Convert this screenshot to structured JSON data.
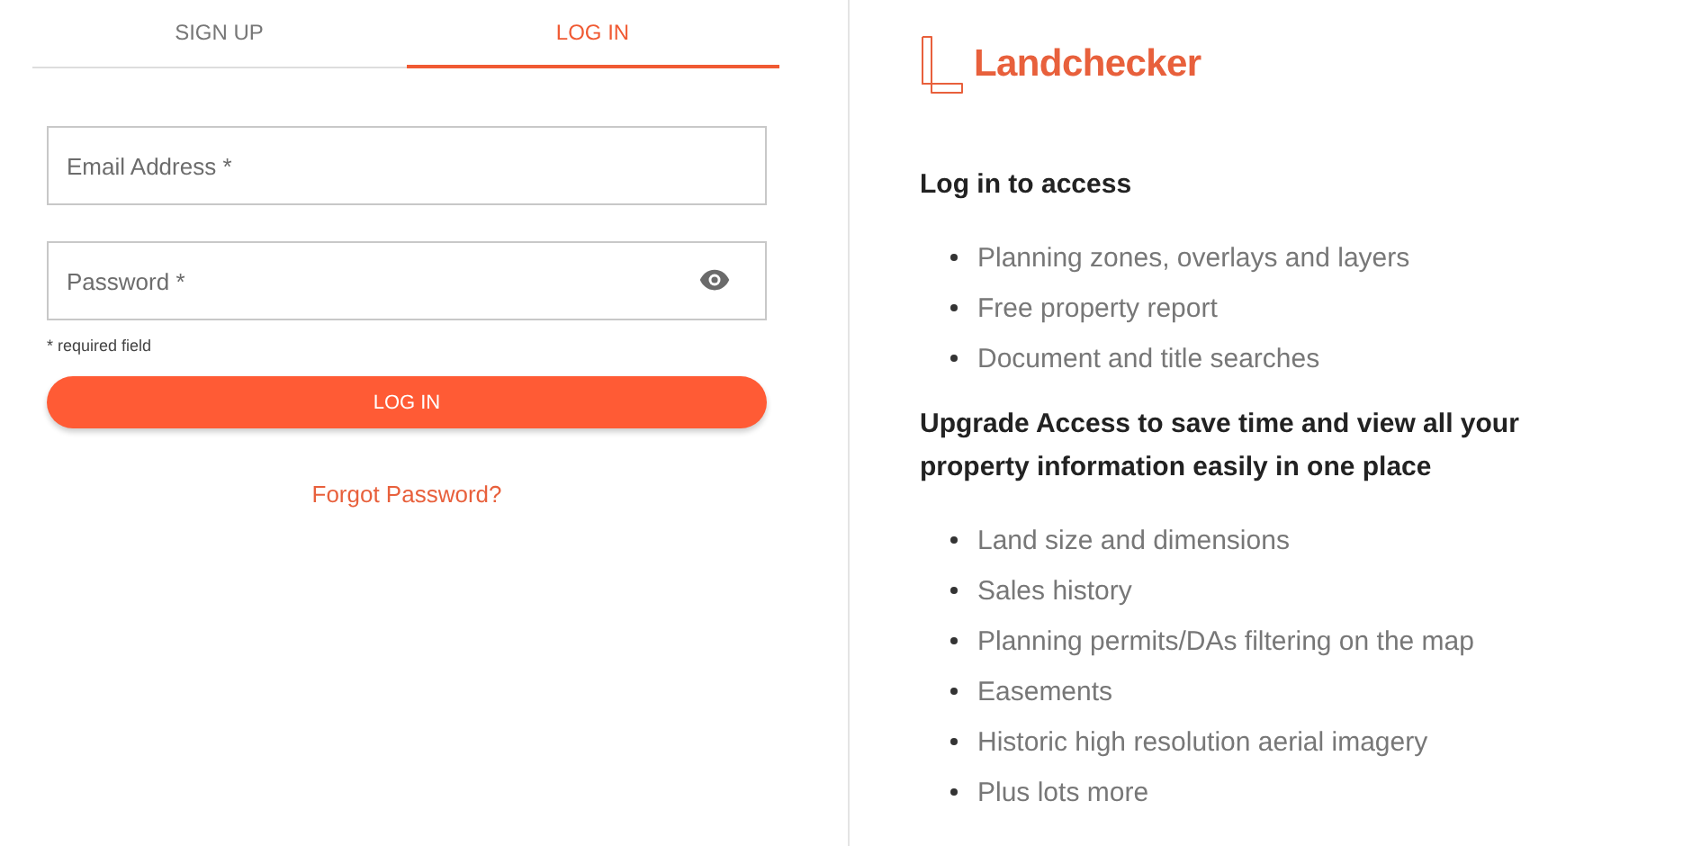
{
  "tabs": [
    {
      "label": "SIGN UP",
      "selected": false
    },
    {
      "label": "LOG IN",
      "selected": true
    }
  ],
  "form": {
    "email": {
      "placeholder": "Email Address *"
    },
    "password": {
      "placeholder": "Password *"
    },
    "hint": "* required field",
    "submit": "LOG IN",
    "forgot": "Forgot Password?"
  },
  "brand": {
    "name": "Landchecker"
  },
  "sections": [
    {
      "heading": "Log in to access",
      "items": [
        "Planning zones, overlays and layers",
        "Free property report",
        "Document and title searches"
      ]
    },
    {
      "heading": "Upgrade Access to save time and view all your property information easily in one place",
      "items": [
        "Land size and dimensions",
        "Sales history",
        "Planning permits/DAs filtering on the map",
        "Easements",
        "Historic high resolution aerial imagery",
        "Plus lots more"
      ]
    }
  ]
}
